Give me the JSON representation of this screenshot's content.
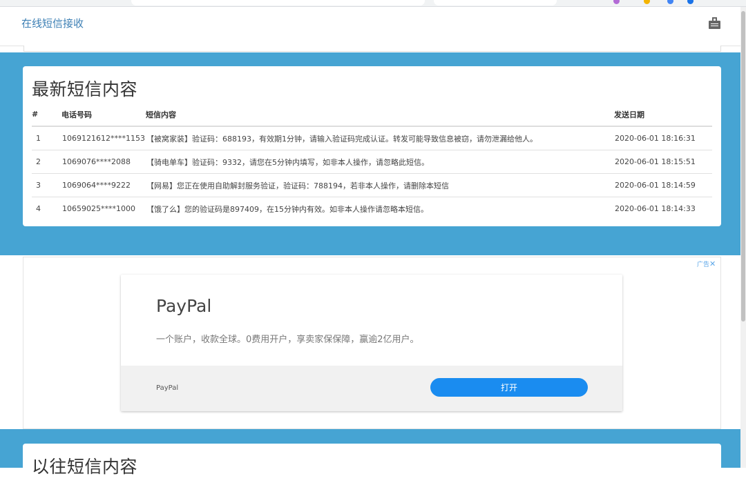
{
  "navbar": {
    "brand": "在线短信接收"
  },
  "latest": {
    "title": "最新短信内容",
    "columns": [
      "#",
      "电话号码",
      "短信内容",
      "发送日期"
    ],
    "rows": [
      {
        "no": "1",
        "phone": "1069121612****1153",
        "content": "【被窝家装】验证码：688193，有效期1分钟，请输入验证码完成认证。转发可能导致信息被窃，请勿泄漏给他人。",
        "date": "2020-06-01 18:16:31"
      },
      {
        "no": "2",
        "phone": "1069076****2088",
        "content": "【骑电单车】验证码：9332，请您在5分钟内填写，如非本人操作，请忽略此短信。",
        "date": "2020-06-01 18:15:51"
      },
      {
        "no": "3",
        "phone": "1069064****9222",
        "content": "【网易】您正在使用自助解封服务验证，验证码：788194，若非本人操作，请删除本短信",
        "date": "2020-06-01 18:14:59"
      },
      {
        "no": "4",
        "phone": "10659025****1000",
        "content": "【饿了么】您的验证码是897409，在15分钟内有效。如非本人操作请忽略本短信。",
        "date": "2020-06-01 18:14:33"
      }
    ]
  },
  "ad": {
    "choice_label": "广告",
    "close_glyph": "✕",
    "title": "PayPal",
    "description": "一个账户，收款全球。0费用开户，享卖家保保障，赢逾2亿用户。",
    "brand": "PayPal",
    "open_button": "打开"
  },
  "previous": {
    "title": "以往短信内容"
  },
  "colors": {
    "accent_blue": "#46a4d3",
    "brand_link": "#3c7fb4",
    "button_blue": "#1a8cf0"
  },
  "icons": {
    "navbar_toggle": "toolbox-icon",
    "ad_close": "close-icon"
  }
}
